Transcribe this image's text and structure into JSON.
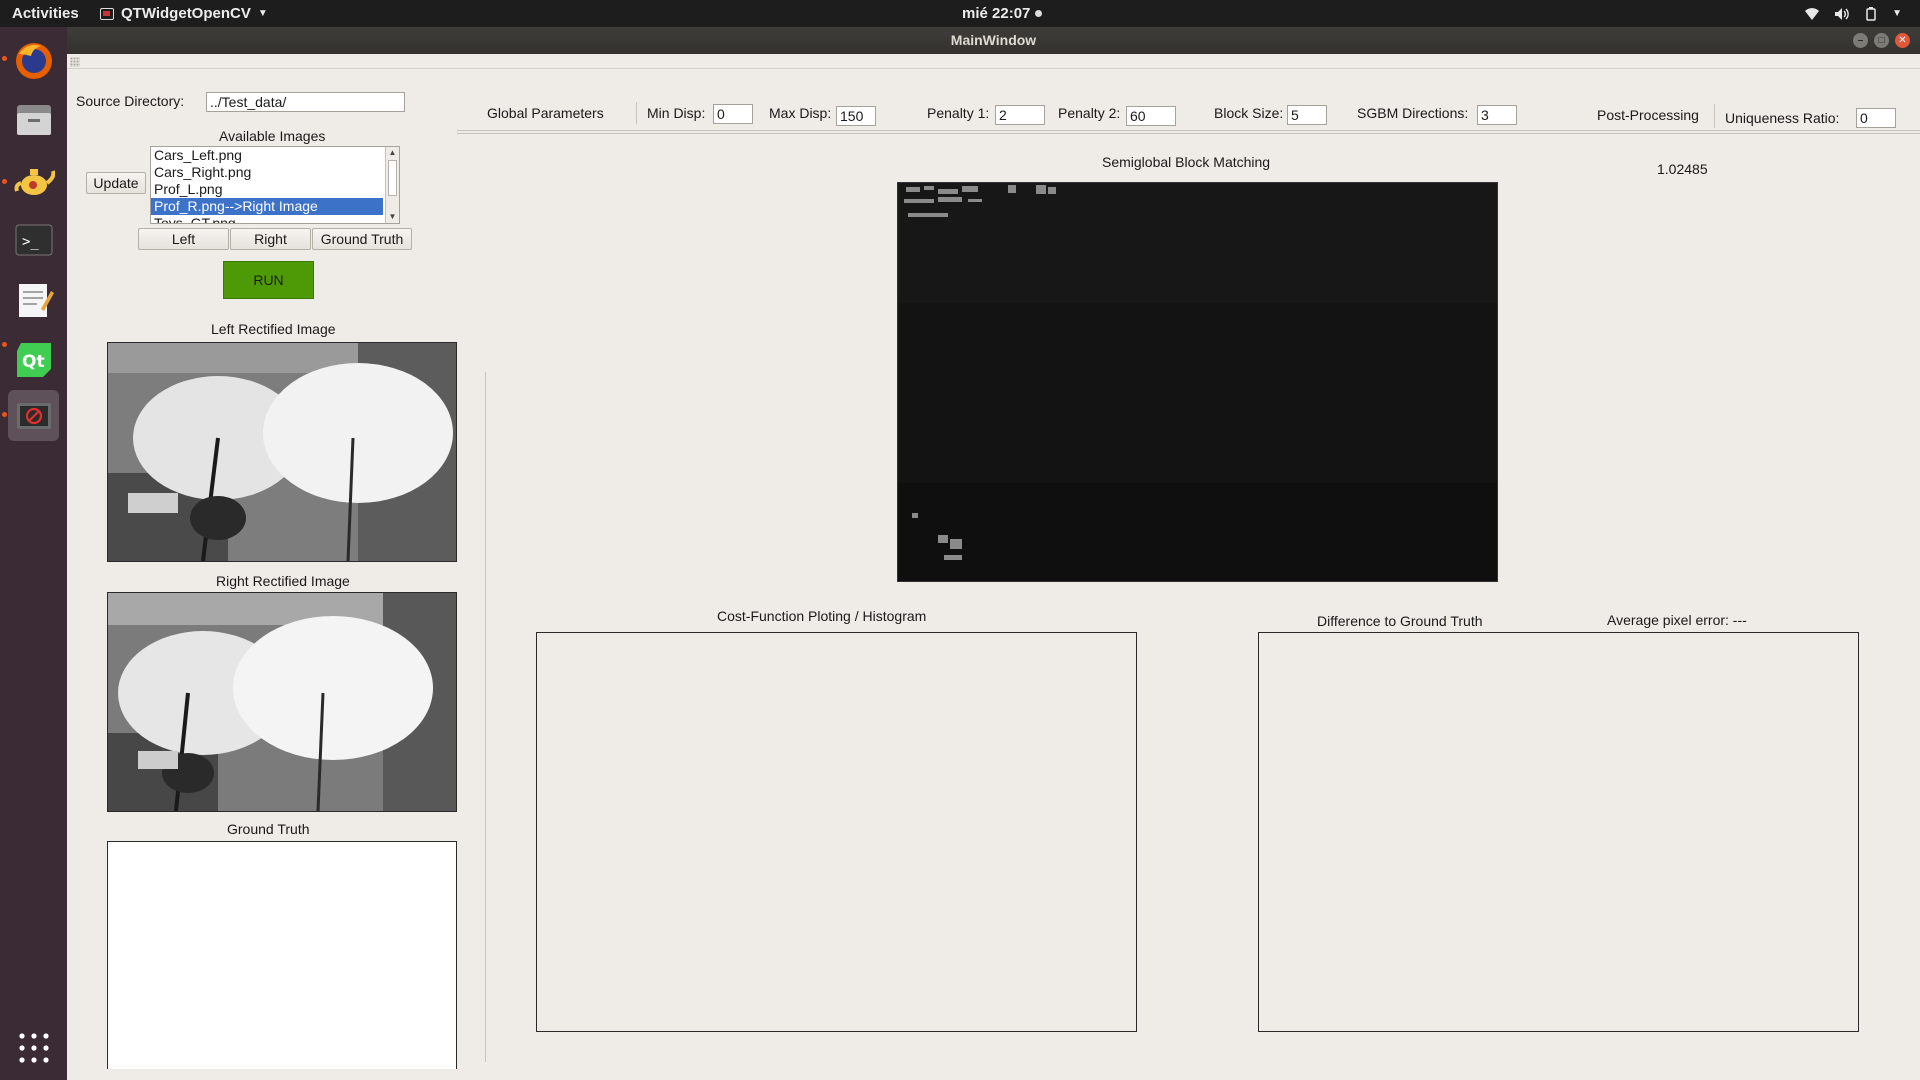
{
  "topbar": {
    "activities": "Activities",
    "app_name": "QTWidgetOpenCV",
    "clock": "mié 22:07"
  },
  "window": {
    "title": "MainWindow"
  },
  "source": {
    "label": "Source Directory:",
    "value": "../Test_data/"
  },
  "images": {
    "header": "Available Images",
    "update_label": "Update",
    "list": [
      "Cars_Left.png",
      "Cars_Right.png",
      "Prof_L.png",
      "Prof_R.png-->Right Image",
      "Toys_GT.png"
    ],
    "selected_index": 3,
    "left_label": "Left",
    "right_label": "Right",
    "gt_label": "Ground Truth",
    "run_label": "RUN"
  },
  "params": {
    "global_label": "Global Parameters",
    "min_disp_label": "Min Disp:",
    "min_disp": "0",
    "max_disp_label": "Max Disp:",
    "max_disp": "150",
    "penalty1_label": "Penalty 1:",
    "penalty1": "2",
    "penalty2_label": "Penalty 2:",
    "penalty2": "60",
    "block_size_label": "Block Size:",
    "block_size": "5",
    "sgbm_dir_label": "SGBM Directions:",
    "sgbm_dir": "3",
    "post_label": "Post-Processing",
    "uniq_label": "Uniqueness Ratio:",
    "uniq": "0"
  },
  "panels": {
    "left_rect_title": "Left Rectified Image",
    "right_rect_title": "Right Rectified Image",
    "gt_title": "Ground Truth",
    "sgbm_title": "Semiglobal Block Matching",
    "time_value": "1.02485",
    "cost_title": "Cost-Function Ploting / Histogram",
    "diff_title": "Difference to Ground Truth",
    "avg_error": "Average pixel error: ---"
  },
  "dock": [
    "firefox-icon",
    "files-icon",
    "teapot-icon",
    "terminal-icon",
    "text-editor-icon",
    "qt-creator-icon",
    "opencv-app-icon",
    "show-apps-icon"
  ]
}
